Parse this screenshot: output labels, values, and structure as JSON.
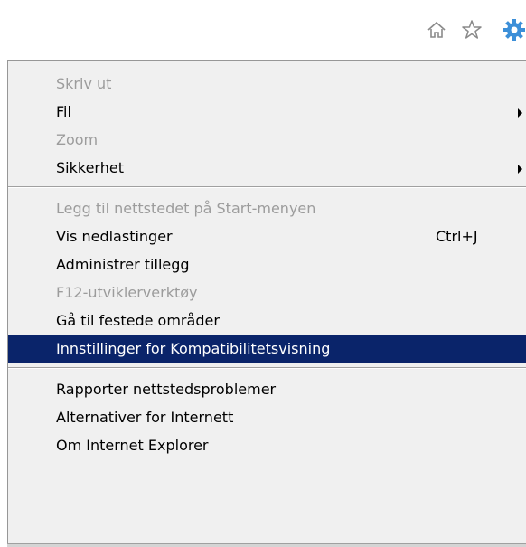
{
  "toolbar": {
    "icons": [
      "home-icon",
      "star-icon",
      "gear-icon"
    ],
    "gear_color": "#3c8fd8"
  },
  "menu": {
    "items": [
      {
        "label": "Skriv ut",
        "disabled": true
      },
      {
        "label": "Fil",
        "disabled": false,
        "submenu": true
      },
      {
        "label": "Zoom",
        "disabled": true
      },
      {
        "label": "Sikkerhet",
        "disabled": false,
        "submenu": true
      },
      {
        "label": "Legg til nettstedet på Start-menyen",
        "disabled": true
      },
      {
        "label": "Vis nedlastinger",
        "disabled": false,
        "shortcut": "Ctrl+J"
      },
      {
        "label": "Administrer tillegg",
        "disabled": false
      },
      {
        "label": "F12-utviklerverktøy",
        "disabled": true
      },
      {
        "label": "Gå til festede områder",
        "disabled": false
      },
      {
        "label": "Innstillinger for Kompatibilitetsvisning",
        "disabled": false,
        "highlighted": true
      },
      {
        "label": "Rapporter nettstedsproblemer",
        "disabled": false
      },
      {
        "label": "Alternativer for Internett",
        "disabled": false
      },
      {
        "label": "Om Internet Explorer",
        "disabled": false
      }
    ],
    "highlight_color": "#0a246a",
    "disabled_color": "#9c9c9c"
  }
}
